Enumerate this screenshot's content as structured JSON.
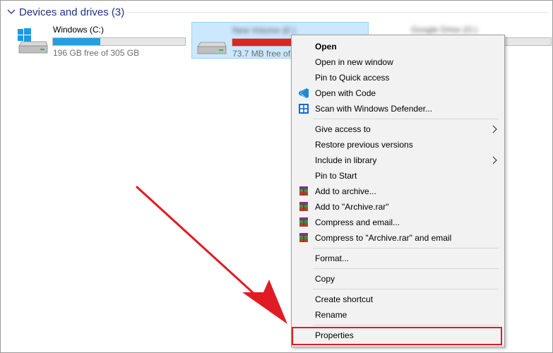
{
  "explorer": {
    "group_title": "Devices and drives (3)",
    "drives": [
      {
        "name": "Windows (C:)",
        "free_text": "196 GB free of 305 GB",
        "used_fraction": 0.36,
        "bar_color": "#26a0da"
      },
      {
        "name": "New Volume (E:)",
        "free_text": "73.7 MB free of",
        "used_fraction": 0.99,
        "bar_color": "#da2626"
      },
      {
        "name": "Google Drive (G:)",
        "free_text": "",
        "used_fraction": 0.0,
        "bar_color": "#26a0da"
      }
    ]
  },
  "context_menu": {
    "items": [
      {
        "label": "Open",
        "bold": true,
        "icon": "",
        "submenu": false
      },
      {
        "label": "Open in new window",
        "bold": false,
        "icon": "",
        "submenu": false
      },
      {
        "label": "Pin to Quick access",
        "bold": false,
        "icon": "",
        "submenu": false
      },
      {
        "label": "Open with Code",
        "bold": false,
        "icon": "vscode-icon",
        "submenu": false
      },
      {
        "label": "Scan with Windows Defender...",
        "bold": false,
        "icon": "defender-icon",
        "submenu": false
      },
      {
        "label": "Give access to",
        "bold": false,
        "icon": "",
        "submenu": true
      },
      {
        "label": "Restore previous versions",
        "bold": false,
        "icon": "",
        "submenu": false
      },
      {
        "label": "Include in library",
        "bold": false,
        "icon": "",
        "submenu": true
      },
      {
        "label": "Pin to Start",
        "bold": false,
        "icon": "",
        "submenu": false
      },
      {
        "label": "Add to archive...",
        "bold": false,
        "icon": "winrar-icon",
        "submenu": false
      },
      {
        "label": "Add to \"Archive.rar\"",
        "bold": false,
        "icon": "winrar-icon",
        "submenu": false
      },
      {
        "label": "Compress and email...",
        "bold": false,
        "icon": "winrar-icon",
        "submenu": false
      },
      {
        "label": "Compress to \"Archive.rar\" and email",
        "bold": false,
        "icon": "winrar-icon",
        "submenu": false
      },
      {
        "label": "Format...",
        "bold": false,
        "icon": "",
        "submenu": false
      },
      {
        "label": "Copy",
        "bold": false,
        "icon": "",
        "submenu": false
      },
      {
        "label": "Create shortcut",
        "bold": false,
        "icon": "",
        "submenu": false
      },
      {
        "label": "Rename",
        "bold": false,
        "icon": "",
        "submenu": false
      },
      {
        "label": "Properties",
        "bold": false,
        "icon": "",
        "submenu": false
      }
    ]
  },
  "annotation": {
    "highlight_color": "#e01b24",
    "target_item": "Properties"
  }
}
